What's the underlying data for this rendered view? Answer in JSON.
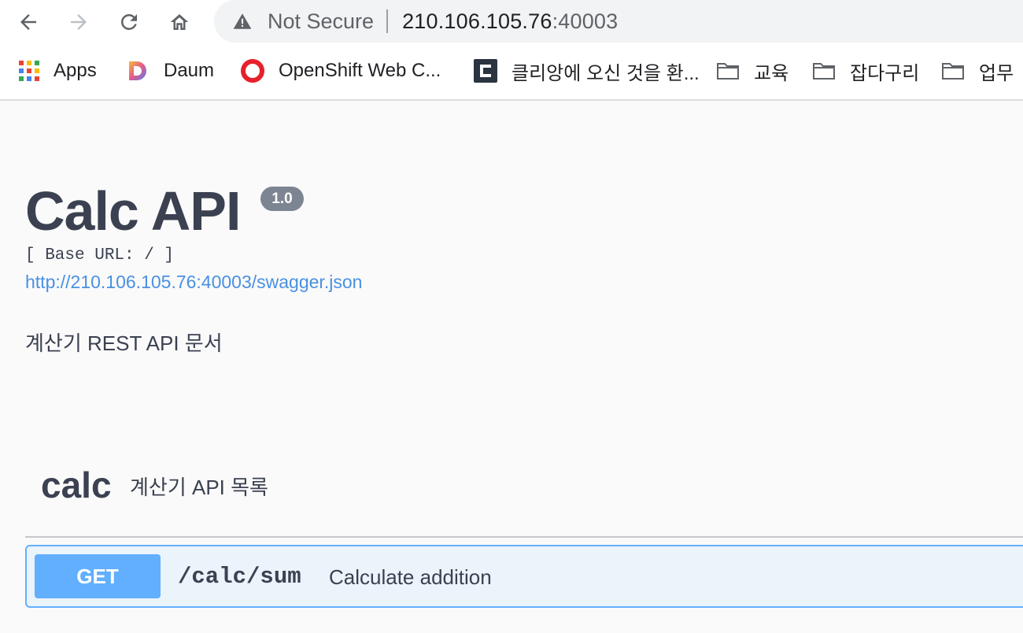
{
  "browser": {
    "security_label": "Not Secure",
    "url_host": "210.106.105.76",
    "url_port": ":40003",
    "nav_icons": [
      "back-arrow-icon",
      "forward-arrow-icon",
      "reload-icon",
      "home-icon"
    ]
  },
  "bookmarks": [
    {
      "label": "Apps",
      "icon": "apps-grid-icon"
    },
    {
      "label": "Daum",
      "icon": "daum-logo-icon"
    },
    {
      "label": "OpenShift Web C...",
      "icon": "openshift-logo-icon"
    },
    {
      "label": "클리앙에 오신 것을 환...",
      "icon": "clien-logo-icon"
    },
    {
      "label": "교육",
      "icon": "folder-icon"
    },
    {
      "label": "잡다구리",
      "icon": "folder-icon"
    },
    {
      "label": "업무",
      "icon": "folder-icon"
    }
  ],
  "info": {
    "title": "Calc API",
    "version": "1.0",
    "base_url": "[ Base URL: / ]",
    "spec_url": "http://210.106.105.76:40003/swagger.json",
    "description": "계산기 REST API 문서"
  },
  "tag": {
    "name": "calc",
    "description": "계산기 API 목록"
  },
  "operations": [
    {
      "method": "GET",
      "path": "/calc/sum",
      "summary": "Calculate addition"
    }
  ],
  "colors": {
    "get_accent": "#61affe",
    "get_background": "#ebf3fb",
    "link": "#4990e2",
    "text": "#3b4151",
    "badge": "#7d8492"
  }
}
